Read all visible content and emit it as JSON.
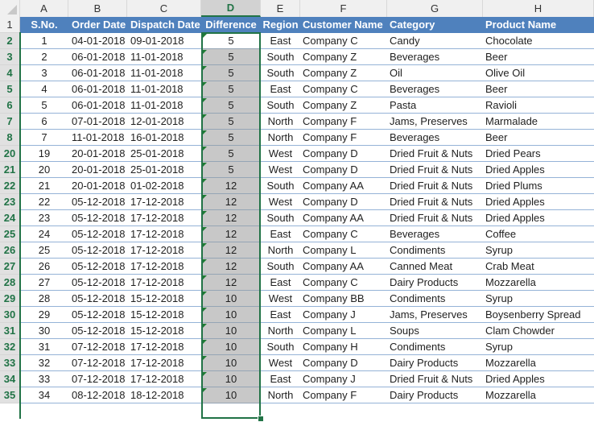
{
  "column_headers": [
    "A",
    "B",
    "C",
    "D",
    "E",
    "F",
    "G",
    "H"
  ],
  "selected_column": "D",
  "header_row": {
    "row_number": "1",
    "labels": [
      "S.No.",
      "Order Date",
      "Dispatch Date",
      "Difference",
      "Region",
      "Customer Name",
      "Category",
      "Product Name"
    ]
  },
  "colors": {
    "header_fill": "#4f81bd",
    "selection_border": "#217346",
    "selected_fill": "#c8c8c8",
    "row_number_text": "#217346"
  },
  "rows": [
    {
      "rn": "2",
      "sno": "1",
      "order": "04-01-2018",
      "dispatch": "09-01-2018",
      "diff": "5",
      "region": "East",
      "customer": "Company C",
      "category": "Candy",
      "product": "Chocolate"
    },
    {
      "rn": "3",
      "sno": "2",
      "order": "06-01-2018",
      "dispatch": "11-01-2018",
      "diff": "5",
      "region": "South",
      "customer": "Company Z",
      "category": "Beverages",
      "product": "Beer"
    },
    {
      "rn": "4",
      "sno": "3",
      "order": "06-01-2018",
      "dispatch": "11-01-2018",
      "diff": "5",
      "region": "South",
      "customer": "Company Z",
      "category": "Oil",
      "product": "Olive Oil"
    },
    {
      "rn": "5",
      "sno": "4",
      "order": "06-01-2018",
      "dispatch": "11-01-2018",
      "diff": "5",
      "region": "East",
      "customer": "Company C",
      "category": "Beverages",
      "product": "Beer"
    },
    {
      "rn": "6",
      "sno": "5",
      "order": "06-01-2018",
      "dispatch": "11-01-2018",
      "diff": "5",
      "region": "South",
      "customer": "Company Z",
      "category": "Pasta",
      "product": "Ravioli"
    },
    {
      "rn": "7",
      "sno": "6",
      "order": "07-01-2018",
      "dispatch": "12-01-2018",
      "diff": "5",
      "region": "North",
      "customer": "Company F",
      "category": "Jams, Preserves",
      "product": "Marmalade"
    },
    {
      "rn": "8",
      "sno": "7",
      "order": "11-01-2018",
      "dispatch": "16-01-2018",
      "diff": "5",
      "region": "North",
      "customer": "Company F",
      "category": "Beverages",
      "product": "Beer"
    },
    {
      "rn": "20",
      "sno": "19",
      "order": "20-01-2018",
      "dispatch": "25-01-2018",
      "diff": "5",
      "region": "West",
      "customer": "Company D",
      "category": "Dried Fruit & Nuts",
      "product": "Dried Pears"
    },
    {
      "rn": "21",
      "sno": "20",
      "order": "20-01-2018",
      "dispatch": "25-01-2018",
      "diff": "5",
      "region": "West",
      "customer": "Company D",
      "category": "Dried Fruit & Nuts",
      "product": "Dried Apples"
    },
    {
      "rn": "22",
      "sno": "21",
      "order": "20-01-2018",
      "dispatch": "01-02-2018",
      "diff": "12",
      "region": "South",
      "customer": "Company AA",
      "category": "Dried Fruit & Nuts",
      "product": "Dried Plums"
    },
    {
      "rn": "23",
      "sno": "22",
      "order": "05-12-2018",
      "dispatch": "17-12-2018",
      "diff": "12",
      "region": "West",
      "customer": "Company D",
      "category": "Dried Fruit & Nuts",
      "product": "Dried Apples"
    },
    {
      "rn": "24",
      "sno": "23",
      "order": "05-12-2018",
      "dispatch": "17-12-2018",
      "diff": "12",
      "region": "South",
      "customer": "Company AA",
      "category": "Dried Fruit & Nuts",
      "product": "Dried Apples"
    },
    {
      "rn": "25",
      "sno": "24",
      "order": "05-12-2018",
      "dispatch": "17-12-2018",
      "diff": "12",
      "region": "East",
      "customer": "Company C",
      "category": "Beverages",
      "product": "Coffee"
    },
    {
      "rn": "26",
      "sno": "25",
      "order": "05-12-2018",
      "dispatch": "17-12-2018",
      "diff": "12",
      "region": "North",
      "customer": "Company L",
      "category": "Condiments",
      "product": "Syrup"
    },
    {
      "rn": "27",
      "sno": "26",
      "order": "05-12-2018",
      "dispatch": "17-12-2018",
      "diff": "12",
      "region": "South",
      "customer": "Company AA",
      "category": "Canned Meat",
      "product": "Crab Meat"
    },
    {
      "rn": "28",
      "sno": "27",
      "order": "05-12-2018",
      "dispatch": "17-12-2018",
      "diff": "12",
      "region": "East",
      "customer": "Company C",
      "category": "Dairy Products",
      "product": "Mozzarella"
    },
    {
      "rn": "29",
      "sno": "28",
      "order": "05-12-2018",
      "dispatch": "15-12-2018",
      "diff": "10",
      "region": "West",
      "customer": "Company BB",
      "category": "Condiments",
      "product": "Syrup"
    },
    {
      "rn": "30",
      "sno": "29",
      "order": "05-12-2018",
      "dispatch": "15-12-2018",
      "diff": "10",
      "region": "East",
      "customer": "Company J",
      "category": "Jams, Preserves",
      "product": "Boysenberry Spread"
    },
    {
      "rn": "31",
      "sno": "30",
      "order": "05-12-2018",
      "dispatch": "15-12-2018",
      "diff": "10",
      "region": "North",
      "customer": "Company L",
      "category": "Soups",
      "product": "Clam Chowder"
    },
    {
      "rn": "32",
      "sno": "31",
      "order": "07-12-2018",
      "dispatch": "17-12-2018",
      "diff": "10",
      "region": "South",
      "customer": "Company H",
      "category": "Condiments",
      "product": "Syrup"
    },
    {
      "rn": "33",
      "sno": "32",
      "order": "07-12-2018",
      "dispatch": "17-12-2018",
      "diff": "10",
      "region": "West",
      "customer": "Company D",
      "category": "Dairy Products",
      "product": "Mozzarella"
    },
    {
      "rn": "34",
      "sno": "33",
      "order": "07-12-2018",
      "dispatch": "17-12-2018",
      "diff": "10",
      "region": "East",
      "customer": "Company J",
      "category": "Dried Fruit & Nuts",
      "product": "Dried Apples"
    },
    {
      "rn": "35",
      "sno": "34",
      "order": "08-12-2018",
      "dispatch": "18-12-2018",
      "diff": "10",
      "region": "North",
      "customer": "Company F",
      "category": "Dairy Products",
      "product": "Mozzarella"
    }
  ]
}
